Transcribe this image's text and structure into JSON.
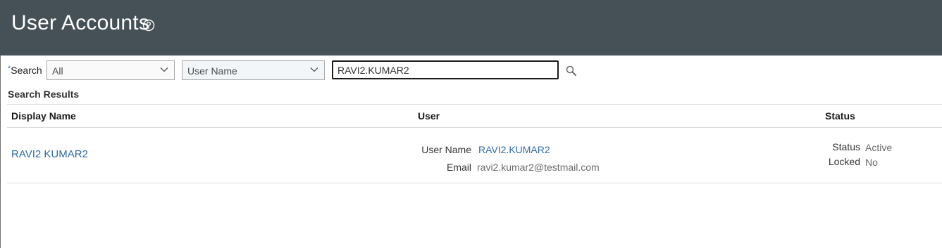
{
  "header": {
    "title": "User Accounts",
    "help_icon": "question-circle-icon"
  },
  "search": {
    "required_marker": "*",
    "label": "Search",
    "scope_value": "All",
    "field_value": "User Name",
    "query_value": "RAVI2.KUMAR2",
    "search_icon": "magnifier-icon"
  },
  "results": {
    "title": "Search Results",
    "columns": [
      "Display Name",
      "User",
      "Status"
    ],
    "rows": [
      {
        "display_name": "RAVI2 KUMAR2",
        "user_name_label": "User Name",
        "user_name": "RAVI2.KUMAR2",
        "email_label": "Email",
        "email": "ravi2.kumar2@testmail.com",
        "status_label": "Status",
        "status": "Active",
        "locked_label": "Locked",
        "locked": "No"
      }
    ]
  },
  "colors": {
    "header_bg": "#465157",
    "link": "#2e6ca4"
  }
}
